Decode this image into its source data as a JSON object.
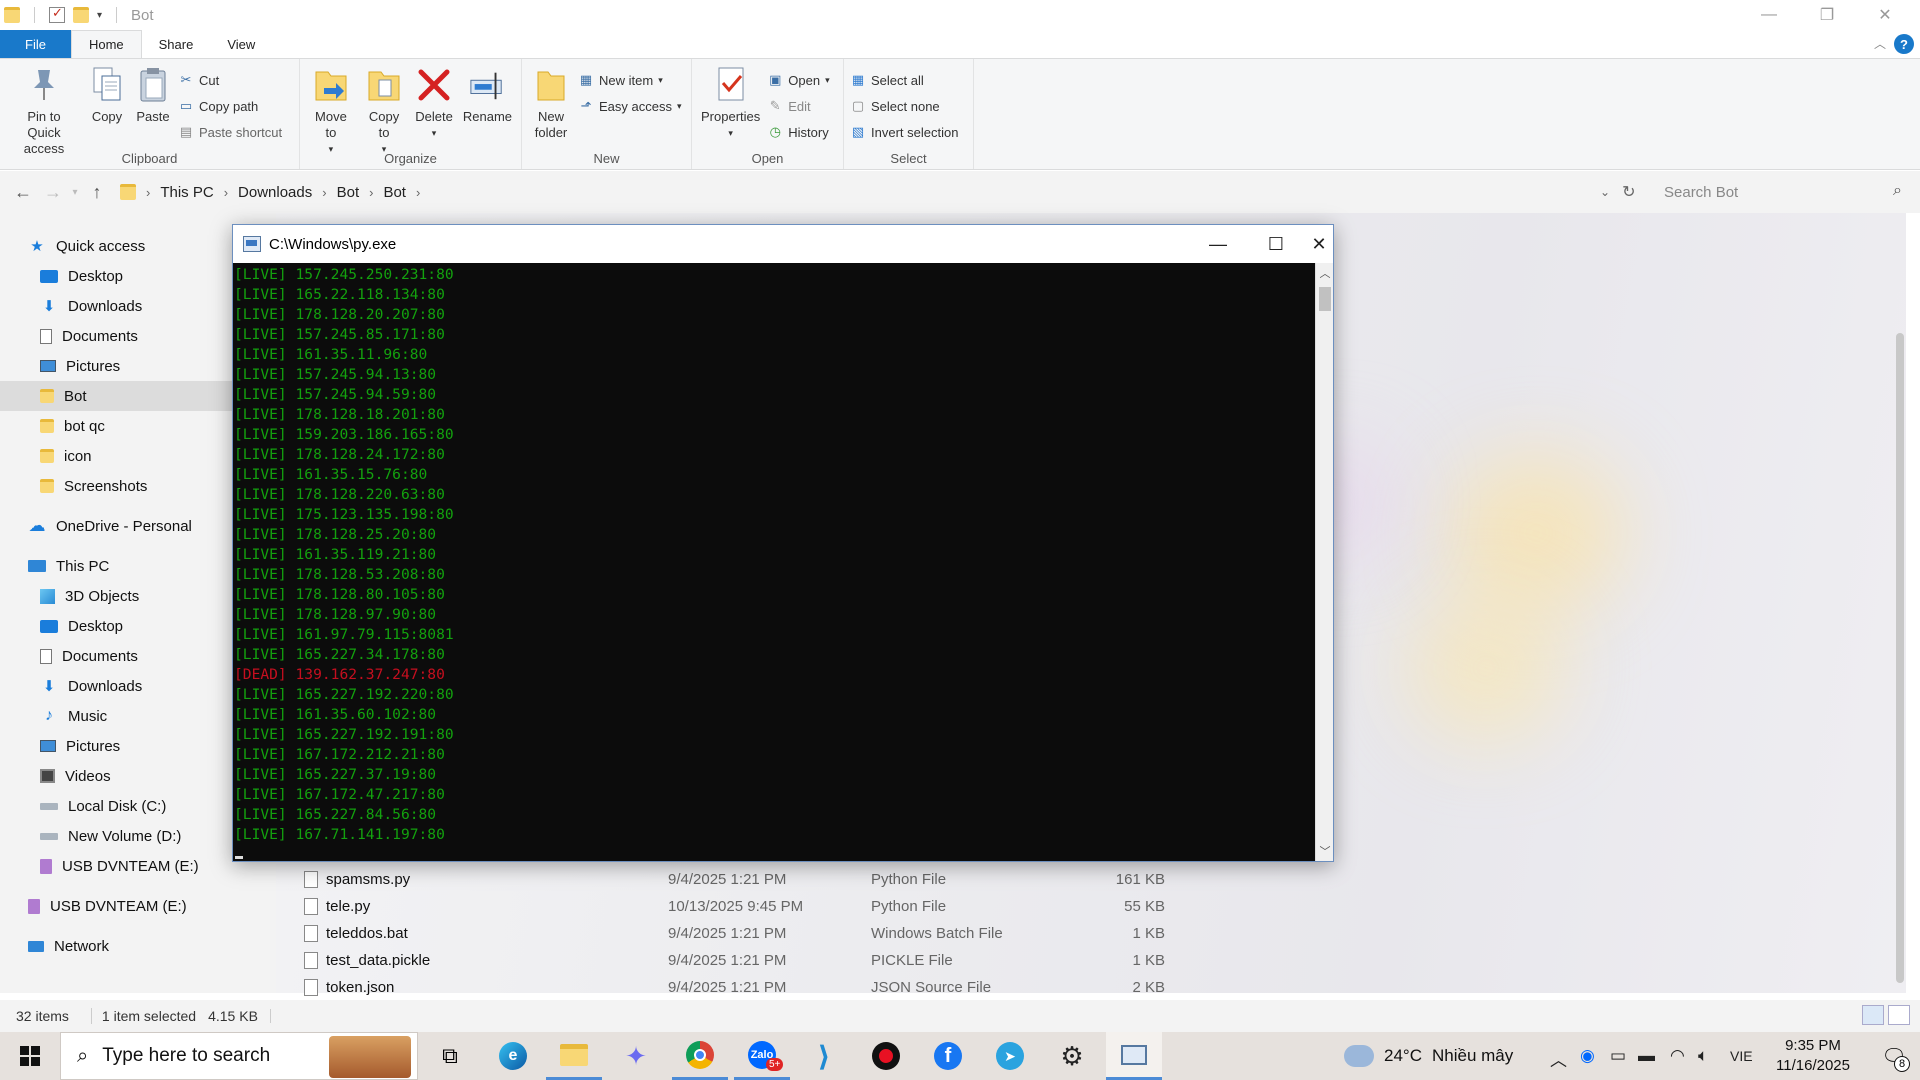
{
  "explorer": {
    "window_title": "Bot",
    "tabs": [
      "File",
      "Home",
      "Share",
      "View"
    ],
    "ribbon": {
      "clipboard": {
        "label": "Clipboard",
        "pin": "Pin to Quick access",
        "copy": "Copy",
        "paste": "Paste",
        "cut": "Cut",
        "copy_path": "Copy path",
        "paste_shortcut": "Paste shortcut"
      },
      "organize": {
        "label": "Organize",
        "move_to": "Move to",
        "copy_to": "Copy to",
        "delete": "Delete",
        "rename": "Rename"
      },
      "new": {
        "label": "New",
        "new_folder": "New folder",
        "new_item": "New item",
        "easy_access": "Easy access"
      },
      "open": {
        "label": "Open",
        "properties": "Properties",
        "open": "Open",
        "edit": "Edit",
        "history": "History"
      },
      "select": {
        "label": "Select",
        "select_all": "Select all",
        "select_none": "Select none",
        "invert": "Invert selection"
      }
    },
    "breadcrumb": [
      "This PC",
      "Downloads",
      "Bot",
      "Bot"
    ],
    "search_placeholder": "Search Bot",
    "nav": [
      {
        "label": "Quick access",
        "icon": "star-icon",
        "indent": 0
      },
      {
        "label": "Desktop",
        "icon": "desktop-icon",
        "indent": 1
      },
      {
        "label": "Downloads",
        "icon": "download-icon",
        "indent": 1
      },
      {
        "label": "Documents",
        "icon": "documents-icon",
        "indent": 1
      },
      {
        "label": "Pictures",
        "icon": "pictures-icon",
        "indent": 1
      },
      {
        "label": "Bot",
        "icon": "folder-icon",
        "indent": 1,
        "selected": true
      },
      {
        "label": "bot qc",
        "icon": "folder-icon",
        "indent": 1
      },
      {
        "label": "icon",
        "icon": "folder-icon",
        "indent": 1
      },
      {
        "label": "Screenshots",
        "icon": "folder-icon",
        "indent": 1
      },
      {
        "label": "OneDrive - Personal",
        "icon": "cloud-icon",
        "indent": 0
      },
      {
        "label": "This PC",
        "icon": "pc-icon",
        "indent": 0
      },
      {
        "label": "3D Objects",
        "icon": "cube-icon",
        "indent": 1
      },
      {
        "label": "Desktop",
        "icon": "desktop-icon",
        "indent": 1
      },
      {
        "label": "Documents",
        "icon": "documents-icon",
        "indent": 1
      },
      {
        "label": "Downloads",
        "icon": "download-icon",
        "indent": 1
      },
      {
        "label": "Music",
        "icon": "music-icon",
        "indent": 1
      },
      {
        "label": "Pictures",
        "icon": "pictures-icon",
        "indent": 1
      },
      {
        "label": "Videos",
        "icon": "video-icon",
        "indent": 1
      },
      {
        "label": "Local Disk (C:)",
        "icon": "drive-icon",
        "indent": 1
      },
      {
        "label": "New Volume (D:)",
        "icon": "drive-icon",
        "indent": 1
      },
      {
        "label": "USB DVNTEAM (E:)",
        "icon": "usb-icon",
        "indent": 1
      },
      {
        "label": "USB DVNTEAM (E:)",
        "icon": "usb-icon",
        "indent": 0
      },
      {
        "label": "Network",
        "icon": "network-icon",
        "indent": 0
      }
    ],
    "files": [
      {
        "name": "spamsms.py",
        "date": "9/4/2025 1:21 PM",
        "type": "Python File",
        "size": "161 KB"
      },
      {
        "name": "tele.py",
        "date": "10/13/2025 9:45 PM",
        "type": "Python File",
        "size": "55 KB"
      },
      {
        "name": "teleddos.bat",
        "date": "9/4/2025 1:21 PM",
        "type": "Windows Batch File",
        "size": "1 KB"
      },
      {
        "name": "test_data.pickle",
        "date": "9/4/2025 1:21 PM",
        "type": "PICKLE File",
        "size": "1 KB"
      },
      {
        "name": "token.json",
        "date": "9/4/2025 1:21 PM",
        "type": "JSON Source File",
        "size": "2 KB"
      }
    ],
    "status": {
      "items": "32 items",
      "selected": "1 item selected",
      "size": "4.15 KB"
    }
  },
  "console": {
    "title": "C:\\Windows\\py.exe",
    "lines": [
      {
        "tag": "[LIVE]",
        "addr": "157.245.250.231:80",
        "status": "live"
      },
      {
        "tag": "[LIVE]",
        "addr": "165.22.118.134:80",
        "status": "live"
      },
      {
        "tag": "[LIVE]",
        "addr": "178.128.20.207:80",
        "status": "live"
      },
      {
        "tag": "[LIVE]",
        "addr": "157.245.85.171:80",
        "status": "live"
      },
      {
        "tag": "[LIVE]",
        "addr": "161.35.11.96:80",
        "status": "live"
      },
      {
        "tag": "[LIVE]",
        "addr": "157.245.94.13:80",
        "status": "live"
      },
      {
        "tag": "[LIVE]",
        "addr": "157.245.94.59:80",
        "status": "live"
      },
      {
        "tag": "[LIVE]",
        "addr": "178.128.18.201:80",
        "status": "live"
      },
      {
        "tag": "[LIVE]",
        "addr": "159.203.186.165:80",
        "status": "live"
      },
      {
        "tag": "[LIVE]",
        "addr": "178.128.24.172:80",
        "status": "live"
      },
      {
        "tag": "[LIVE]",
        "addr": "161.35.15.76:80",
        "status": "live"
      },
      {
        "tag": "[LIVE]",
        "addr": "178.128.220.63:80",
        "status": "live"
      },
      {
        "tag": "[LIVE]",
        "addr": "175.123.135.198:80",
        "status": "live"
      },
      {
        "tag": "[LIVE]",
        "addr": "178.128.25.20:80",
        "status": "live"
      },
      {
        "tag": "[LIVE]",
        "addr": "161.35.119.21:80",
        "status": "live"
      },
      {
        "tag": "[LIVE]",
        "addr": "178.128.53.208:80",
        "status": "live"
      },
      {
        "tag": "[LIVE]",
        "addr": "178.128.80.105:80",
        "status": "live"
      },
      {
        "tag": "[LIVE]",
        "addr": "178.128.97.90:80",
        "status": "live"
      },
      {
        "tag": "[LIVE]",
        "addr": "161.97.79.115:8081",
        "status": "live"
      },
      {
        "tag": "[LIVE]",
        "addr": "165.227.34.178:80",
        "status": "live"
      },
      {
        "tag": "[DEAD]",
        "addr": "139.162.37.247:80",
        "status": "dead"
      },
      {
        "tag": "[LIVE]",
        "addr": "165.227.192.220:80",
        "status": "live"
      },
      {
        "tag": "[LIVE]",
        "addr": "161.35.60.102:80",
        "status": "live"
      },
      {
        "tag": "[LIVE]",
        "addr": "165.227.192.191:80",
        "status": "live"
      },
      {
        "tag": "[LIVE]",
        "addr": "167.172.212.21:80",
        "status": "live"
      },
      {
        "tag": "[LIVE]",
        "addr": "165.227.37.19:80",
        "status": "live"
      },
      {
        "tag": "[LIVE]",
        "addr": "167.172.47.217:80",
        "status": "live"
      },
      {
        "tag": "[LIVE]",
        "addr": "165.227.84.56:80",
        "status": "live"
      },
      {
        "tag": "[LIVE]",
        "addr": "167.71.141.197:80",
        "status": "live"
      }
    ]
  },
  "taskbar": {
    "search_placeholder": "Type here to search",
    "weather": {
      "temp": "24°C",
      "desc": "Nhiều mây"
    },
    "lang": "VIE",
    "time": "9:35 PM",
    "date": "11/16/2025",
    "notification_count": "8",
    "zalo_badge": "5+",
    "apps": [
      "task-view-icon",
      "edge-icon",
      "file-explorer-icon",
      "copilot-icon",
      "chrome-icon",
      "zalo-icon",
      "vscode-icon",
      "record-icon",
      "facebook-icon",
      "telegram-icon",
      "chatgpt-icon",
      "python-console-icon"
    ]
  },
  "colors": {
    "accent": "#1979ca",
    "console_live": "#13a10e",
    "console_dead": "#c50f1f",
    "console_bg": "#0c0c0c"
  }
}
